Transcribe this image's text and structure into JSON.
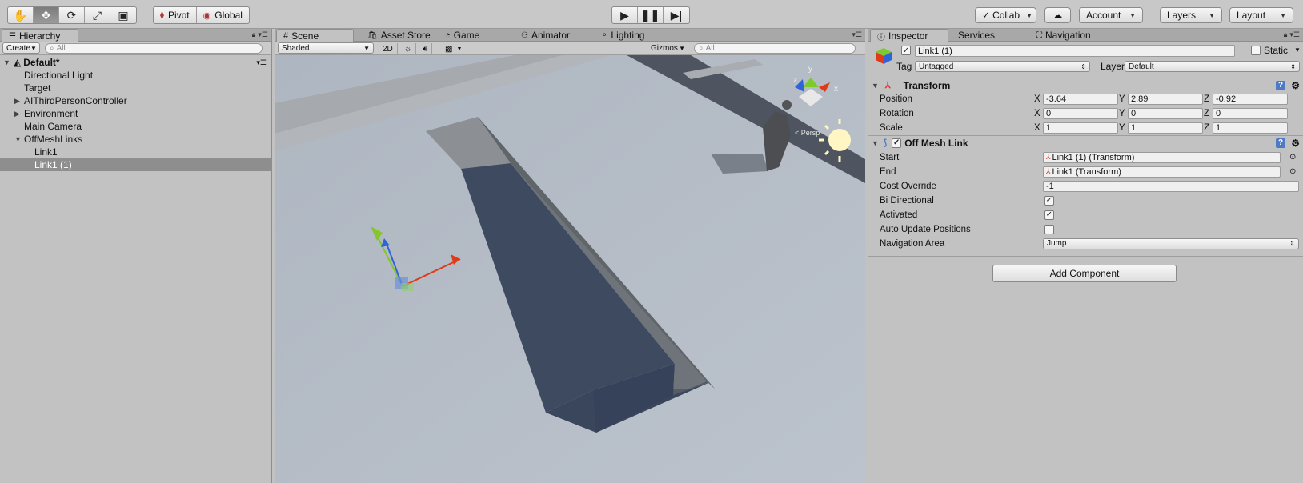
{
  "toolbar": {
    "tools": [
      "hand-icon",
      "move-icon",
      "rotate-icon",
      "scale-icon",
      "rect-icon"
    ],
    "pivot": "Pivot",
    "global": "Global",
    "collab": "Collab",
    "account": "Account",
    "layers": "Layers",
    "layout": "Layout"
  },
  "hierarchy": {
    "tab": "Hierarchy",
    "create": "Create",
    "search_placeholder": "All",
    "scene_name": "Default*",
    "items": [
      {
        "label": "Directional Light",
        "indent": 1,
        "expander": ""
      },
      {
        "label": "Target",
        "indent": 1,
        "expander": ""
      },
      {
        "label": "AIThirdPersonController",
        "indent": 1,
        "expander": "▶"
      },
      {
        "label": "Environment",
        "indent": 1,
        "expander": "▶"
      },
      {
        "label": "Main Camera",
        "indent": 1,
        "expander": ""
      },
      {
        "label": "OffMeshLinks",
        "indent": 1,
        "expander": "▼"
      },
      {
        "label": "Link1",
        "indent": 2,
        "expander": ""
      },
      {
        "label": "Link1 (1)",
        "indent": 2,
        "expander": "",
        "selected": true
      }
    ]
  },
  "scene": {
    "tabs": [
      "Scene",
      "Asset Store",
      "Game",
      "Animator",
      "Lighting"
    ],
    "shading": "Shaded",
    "mode_2d": "2D",
    "gizmos": "Gizmos",
    "search_placeholder": "All",
    "persp_label": "< Persp",
    "axis_x": "x",
    "axis_y": "y",
    "axis_z": "z"
  },
  "inspector": {
    "tabs": [
      "Inspector",
      "Services",
      "Navigation"
    ],
    "object_name": "Link1 (1)",
    "static_label": "Static",
    "tag_label": "Tag",
    "tag_value": "Untagged",
    "layer_label": "Layer",
    "layer_value": "Default",
    "transform": {
      "title": "Transform",
      "position": {
        "label": "Position",
        "x": "-3.64",
        "y": "2.89",
        "z": "-0.92"
      },
      "rotation": {
        "label": "Rotation",
        "x": "0",
        "y": "0",
        "z": "0"
      },
      "scale": {
        "label": "Scale",
        "x": "1",
        "y": "1",
        "z": "1"
      }
    },
    "offmesh": {
      "title": "Off Mesh Link",
      "start_label": "Start",
      "start_value": "Link1 (1) (Transform)",
      "end_label": "End",
      "end_value": "Link1 (Transform)",
      "cost_label": "Cost Override",
      "cost_value": "-1",
      "bidir_label": "Bi Directional",
      "bidir_checked": true,
      "activated_label": "Activated",
      "activated_checked": true,
      "auto_update_label": "Auto Update Positions",
      "auto_update_checked": false,
      "area_label": "Navigation Area",
      "area_value": "Jump"
    },
    "add_component": "Add Component",
    "axis_labels": {
      "x": "X",
      "y": "Y",
      "z": "Z"
    }
  },
  "colors": {
    "panel_bg": "#c2c2c2",
    "scene_sky": "#b8bec7",
    "wall_dark": "#3f4c63",
    "selection": "#8e8e8e"
  }
}
